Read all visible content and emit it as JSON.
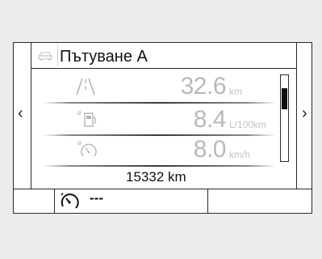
{
  "header": {
    "title": "Пътуване A",
    "icon": "car-icon"
  },
  "nav": {
    "prev_label": "‹",
    "next_label": "›"
  },
  "rows": [
    {
      "icon": "road-distance-icon",
      "value": "32.6",
      "unit": "km"
    },
    {
      "icon": "fuel-consumption-icon",
      "value": "8.4",
      "unit": "L/100km"
    },
    {
      "icon": "average-speed-icon",
      "value": "8.0",
      "unit": "km/h"
    }
  ],
  "scroll": {
    "position_fraction": 0.2
  },
  "odometer": {
    "value": "15332 km"
  },
  "bottom": {
    "icon": "speedometer-icon",
    "value": "---"
  }
}
